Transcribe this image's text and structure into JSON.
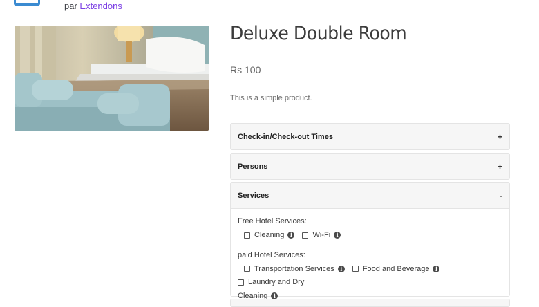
{
  "header": {
    "byline_prefix": "par",
    "vendor_link": "Extendons",
    "logo_icon": "shop-logo-icon"
  },
  "product": {
    "title": "Deluxe Double Room",
    "price": "Rs 100",
    "short_description": "This is a simple product.",
    "image_icon": "hotel-room-photo"
  },
  "accordion": [
    {
      "title": "Check-in/Check-out Times",
      "toggle": "+"
    },
    {
      "title": "Persons",
      "toggle": "+"
    },
    {
      "title": "Services",
      "toggle": "-"
    }
  ],
  "services": {
    "free_label": "Free Hotel Services:",
    "free_options": [
      "Cleaning",
      "Wi-Fi"
    ],
    "paid_label": "paid Hotel Services:",
    "paid_options": [
      "Transportation Services",
      "Food and Beverage",
      "Laundry and Dry",
      "Cleaning"
    ],
    "info_icon": "info-icon",
    "info_glyph": "i"
  }
}
